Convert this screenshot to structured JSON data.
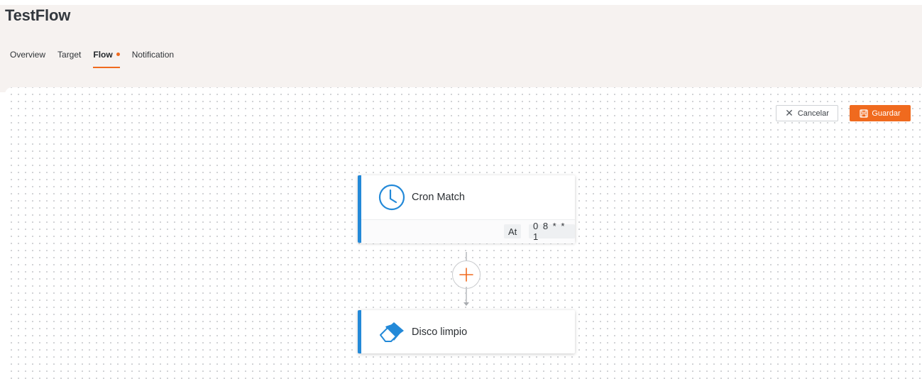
{
  "app": {
    "title": "TestFlow"
  },
  "tabs": [
    {
      "label": "Overview",
      "active": false
    },
    {
      "label": "Target",
      "active": false
    },
    {
      "label": "Flow",
      "active": true,
      "modified": true
    },
    {
      "label": "Notification",
      "active": false
    }
  ],
  "toolbar": {
    "cancel_label": "Cancelar",
    "cancel_icon": "close-icon",
    "save_label": "Guardar",
    "save_icon": "floppy-disk-icon"
  },
  "flow": {
    "nodes": [
      {
        "title": "Cron Match",
        "icon": "clock-icon",
        "params": {
          "label": "At",
          "value": "0 8 * * 1"
        }
      },
      {
        "title": "Disco limpio",
        "icon": "eraser-icon"
      }
    ],
    "add_step_icon": "plus-icon"
  },
  "colors": {
    "accent": "#f06a1e",
    "node_border": "#2389d8",
    "header_bg": "#f6f2f0"
  }
}
